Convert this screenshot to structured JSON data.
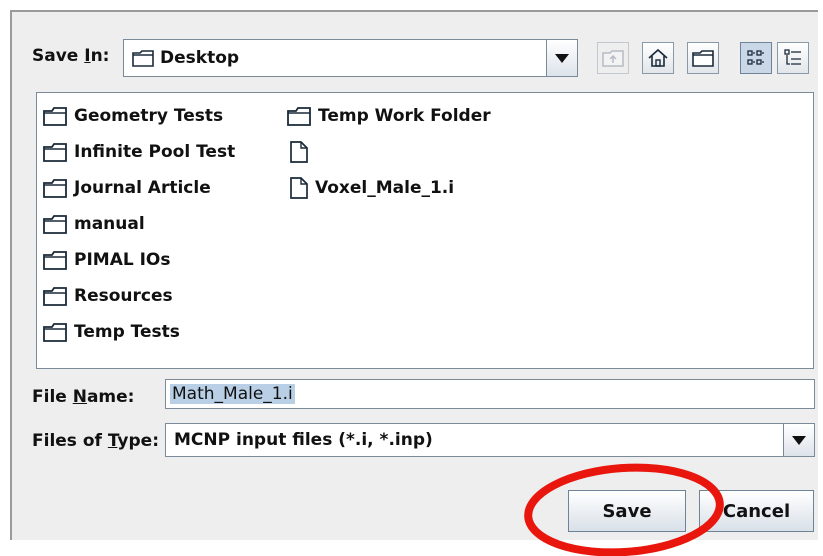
{
  "save_in": {
    "label_prefix": "Save ",
    "label_mnemonic": "I",
    "label_suffix": "n:",
    "value": "Desktop"
  },
  "toolbar": {
    "icons": [
      "up-one-level-icon",
      "home-icon",
      "new-folder-icon",
      "list-view-icon",
      "details-view-icon"
    ]
  },
  "files": {
    "column1": [
      {
        "name": "Geometry Tests",
        "type": "folder"
      },
      {
        "name": "Infinite Pool Test",
        "type": "folder"
      },
      {
        "name": "Journal Article",
        "type": "folder"
      },
      {
        "name": "manual",
        "type": "folder"
      },
      {
        "name": "PIMAL IOs",
        "type": "folder"
      },
      {
        "name": "Resources",
        "type": "folder"
      },
      {
        "name": "Temp Tests",
        "type": "folder"
      }
    ],
    "column2": [
      {
        "name": "Temp Work Folder",
        "type": "folder"
      },
      {
        "name": "",
        "type": "file"
      },
      {
        "name": "Voxel_Male_1.i",
        "type": "file"
      }
    ]
  },
  "file_name": {
    "label_prefix": "File ",
    "label_mnemonic": "N",
    "label_suffix": "ame:",
    "value": "Math_Male_1.i"
  },
  "file_type": {
    "label_prefix": "Files of ",
    "label_mnemonic": "T",
    "label_suffix": "ype:",
    "value": "MCNP input files (*.i, *.inp)"
  },
  "buttons": {
    "save": "Save",
    "cancel": "Cancel"
  },
  "colors": {
    "highlight_circle": "#e8160d",
    "selection": "#b8cfe5"
  }
}
